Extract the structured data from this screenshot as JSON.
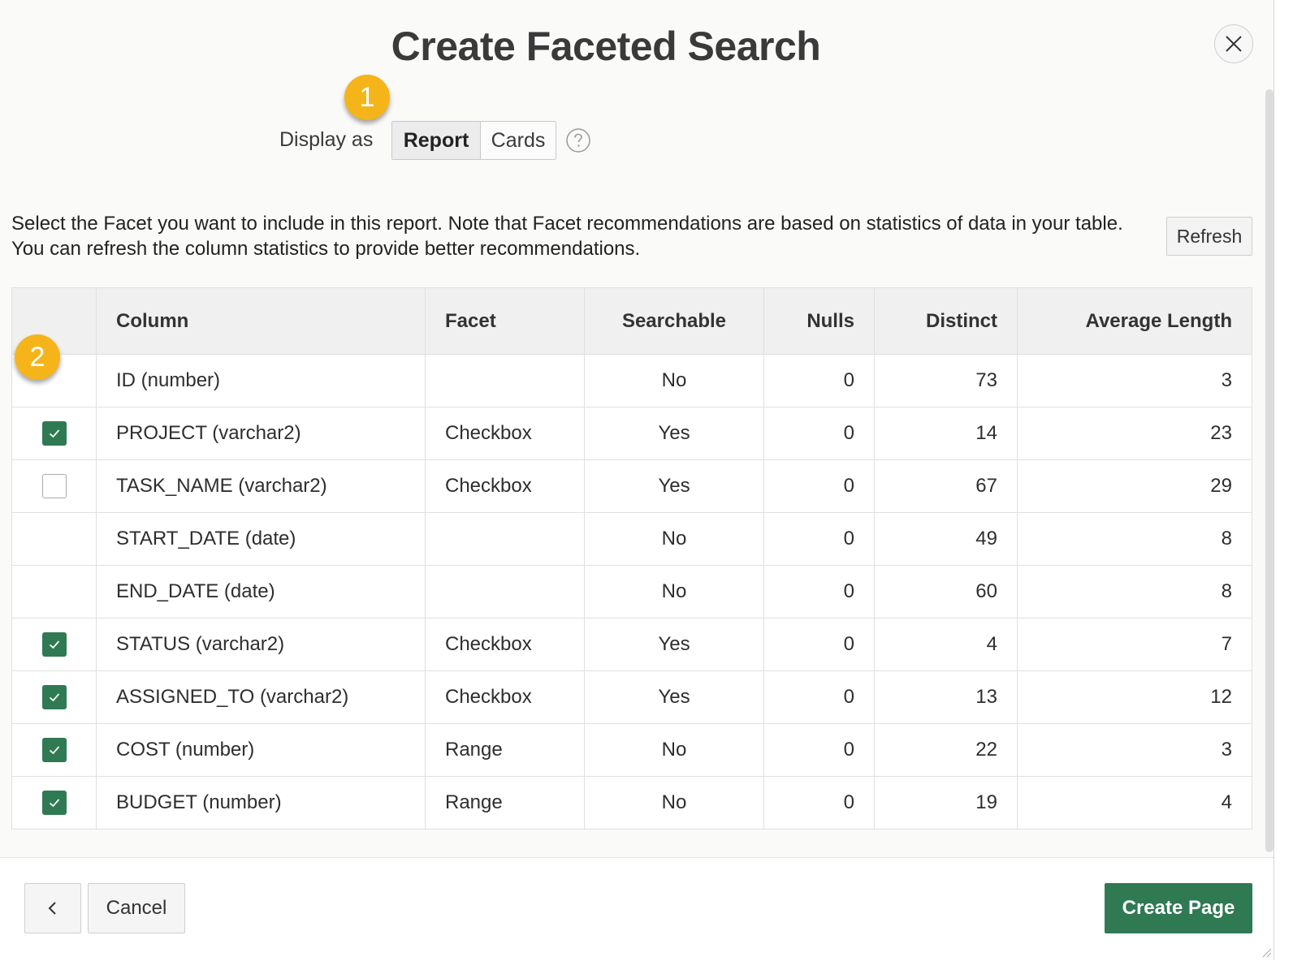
{
  "dialog": {
    "title": "Create Faceted Search"
  },
  "markers": [
    "1",
    "2"
  ],
  "display_as": {
    "label": "Display as",
    "options": [
      "Report",
      "Cards"
    ],
    "selected": "Report"
  },
  "description": {
    "line1": "Select the Facet you want to include in this report. Note that Facet recommendations are based on statistics of data in your table.",
    "line2": "You can refresh the column statistics to provide better recommendations."
  },
  "refresh_label": "Refresh",
  "table": {
    "headers": [
      "Column",
      "Facet",
      "Searchable",
      "Nulls",
      "Distinct",
      "Average Length"
    ],
    "rows": [
      {
        "checkbox": "none",
        "column": "ID (number)",
        "facet": "",
        "searchable": "No",
        "nulls": "0",
        "distinct": "73",
        "avg_length": "3"
      },
      {
        "checkbox": "checked",
        "column": "PROJECT (varchar2)",
        "facet": "Checkbox",
        "searchable": "Yes",
        "nulls": "0",
        "distinct": "14",
        "avg_length": "23"
      },
      {
        "checkbox": "unchecked",
        "column": "TASK_NAME (varchar2)",
        "facet": "Checkbox",
        "searchable": "Yes",
        "nulls": "0",
        "distinct": "67",
        "avg_length": "29"
      },
      {
        "checkbox": "none",
        "column": "START_DATE (date)",
        "facet": "",
        "searchable": "No",
        "nulls": "0",
        "distinct": "49",
        "avg_length": "8"
      },
      {
        "checkbox": "none",
        "column": "END_DATE (date)",
        "facet": "",
        "searchable": "No",
        "nulls": "0",
        "distinct": "60",
        "avg_length": "8"
      },
      {
        "checkbox": "checked",
        "column": "STATUS (varchar2)",
        "facet": "Checkbox",
        "searchable": "Yes",
        "nulls": "0",
        "distinct": "4",
        "avg_length": "7"
      },
      {
        "checkbox": "checked",
        "column": "ASSIGNED_TO (varchar2)",
        "facet": "Checkbox",
        "searchable": "Yes",
        "nulls": "0",
        "distinct": "13",
        "avg_length": "12"
      },
      {
        "checkbox": "checked",
        "column": "COST (number)",
        "facet": "Range",
        "searchable": "No",
        "nulls": "0",
        "distinct": "22",
        "avg_length": "3"
      },
      {
        "checkbox": "checked",
        "column": "BUDGET (number)",
        "facet": "Range",
        "searchable": "No",
        "nulls": "0",
        "distinct": "19",
        "avg_length": "4"
      }
    ]
  },
  "footer": {
    "cancel_label": "Cancel",
    "create_label": "Create Page"
  },
  "icons": {
    "close": "close-icon",
    "help": "help-icon",
    "back": "chevron-left-icon",
    "check": "check-icon"
  },
  "colors": {
    "accent_green": "#2f7a52",
    "marker_yellow": "#f5b51a"
  }
}
